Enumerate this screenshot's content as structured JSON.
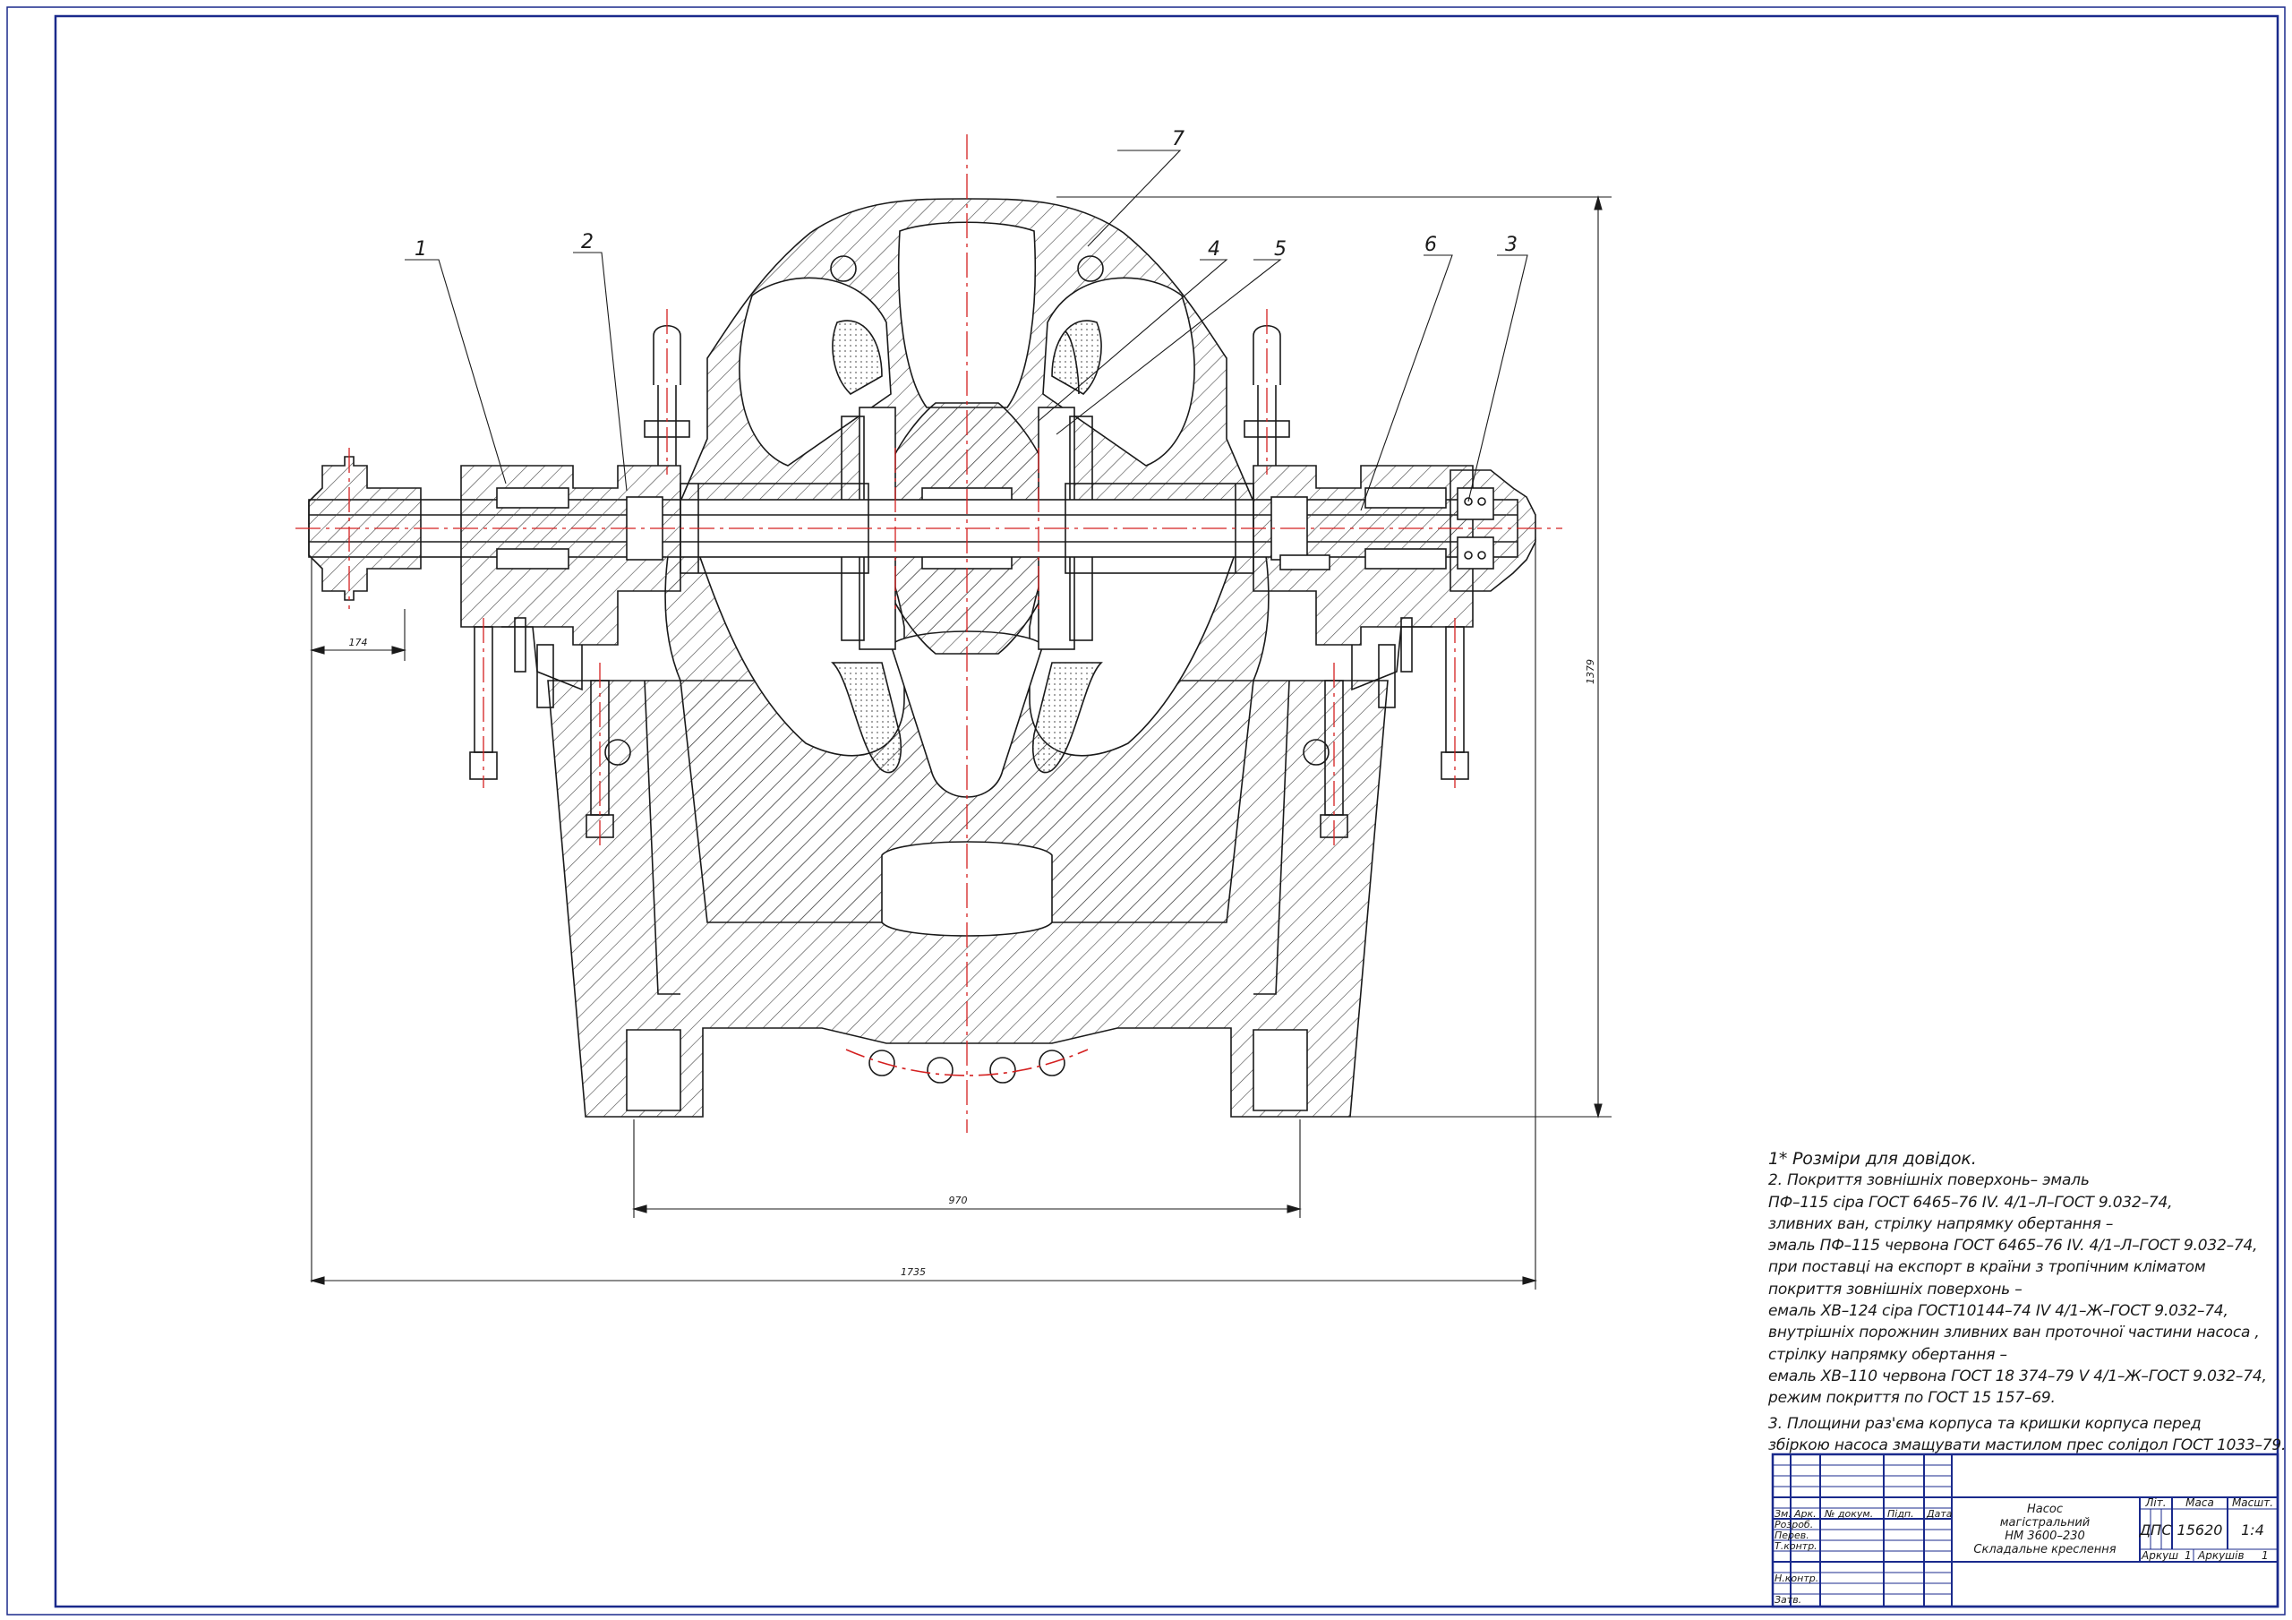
{
  "callouts": [
    "1",
    "2",
    "7",
    "4",
    "5",
    "6",
    "3"
  ],
  "dimensions": {
    "shaft_end": "174",
    "height": "1379",
    "feet_span": "970",
    "overall_length": "1735"
  },
  "notes": [
    "1* Розміри для довідок.",
    "2. Покриття зовнішніх поверхонь– эмаль",
    " ПФ–115 сіра ГОСТ 6465–76 IV. 4/1–Л–ГОСТ 9.032–74,",
    "зливних ван, стрілку напрямку обертання –",
    "эмаль ПФ–115 червона ГОСТ 6465–76 IV. 4/1–Л–ГОСТ 9.032–74,",
    " при поставці на експорт в країни з тропічним кліматом",
    "покриття зовнішніх поверхонь –",
    "емаль ХВ–124 сіра ГОСТ10144–74 IV 4/1–Ж–ГОСТ 9.032–74,",
    "внутрішніх порожнин зливних ван проточної частини насоса ,",
    "стрілку напрямку обертання –",
    "емаль ХВ–110 червона ГОСТ 18 374–79 V 4/1–Ж–ГОСТ 9.032–74,",
    "режим покриття по ГОСТ 15 157–69.",
    "3. Площини раз'єма корпуса та кришки корпуса перед",
    "збіркою насоса змащувати мастилом прес солідол ГОСТ 1033–79."
  ],
  "title_block": {
    "col_headers": [
      "Зм.",
      "Арк.",
      "№ докум.",
      "Підп.",
      "Дата"
    ],
    "roles": [
      "Розроб.",
      "Перев.",
      "Т.контр.",
      "Н.контр.",
      "Затв."
    ],
    "title_lines": [
      "Насос",
      "магістральний",
      "НМ 3600–230",
      "Складальне креслення"
    ],
    "lit_label": "Літ.",
    "mass_label": "Маса",
    "scale_label": "Масшт.",
    "lit_values": [
      "Д",
      "П",
      "С"
    ],
    "mass_value": "15620",
    "scale_value": "1:4",
    "sheet_label": "Аркуш",
    "sheet_value": "1",
    "sheets_label": "Аркушів",
    "sheets_value": "1"
  },
  "colors": {
    "line": "#1a1a1a",
    "frame": "#1a2a8c",
    "centerline": "#d42020"
  }
}
